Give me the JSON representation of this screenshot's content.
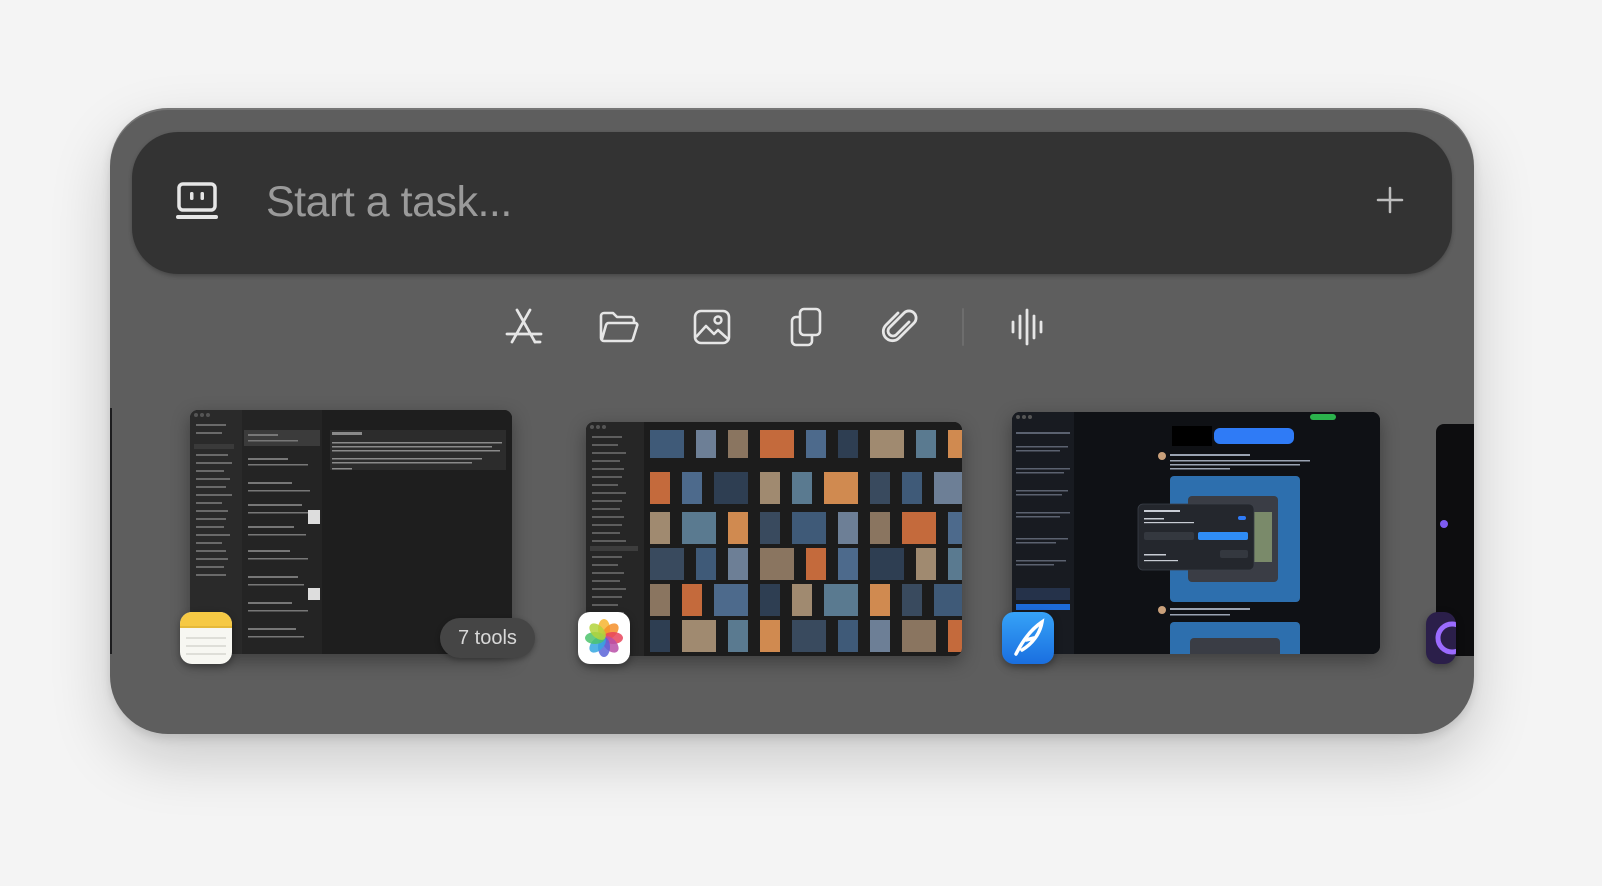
{
  "input": {
    "placeholder": "Start a task..."
  },
  "toolbar": {
    "tools": [
      {
        "name": "app-store",
        "icon": "app-store-icon"
      },
      {
        "name": "folder",
        "icon": "folder-icon"
      },
      {
        "name": "image",
        "icon": "image-icon"
      },
      {
        "name": "copy",
        "icon": "copy-icon"
      },
      {
        "name": "attachment",
        "icon": "paperclip-icon"
      },
      {
        "name": "voice",
        "icon": "waveform-icon"
      }
    ]
  },
  "windows": [
    {
      "app": "Notes",
      "icon": "notes-app-icon",
      "badge": "7 tools"
    },
    {
      "app": "Photos",
      "icon": "photos-app-icon"
    },
    {
      "app": "Ghostty Social",
      "icon": "feather-app-icon"
    }
  ],
  "colors": {
    "panel": "#5e5e5e",
    "input_bar": "#333333",
    "icon": "#e6e6e6",
    "placeholder": "#9a9a9a"
  }
}
